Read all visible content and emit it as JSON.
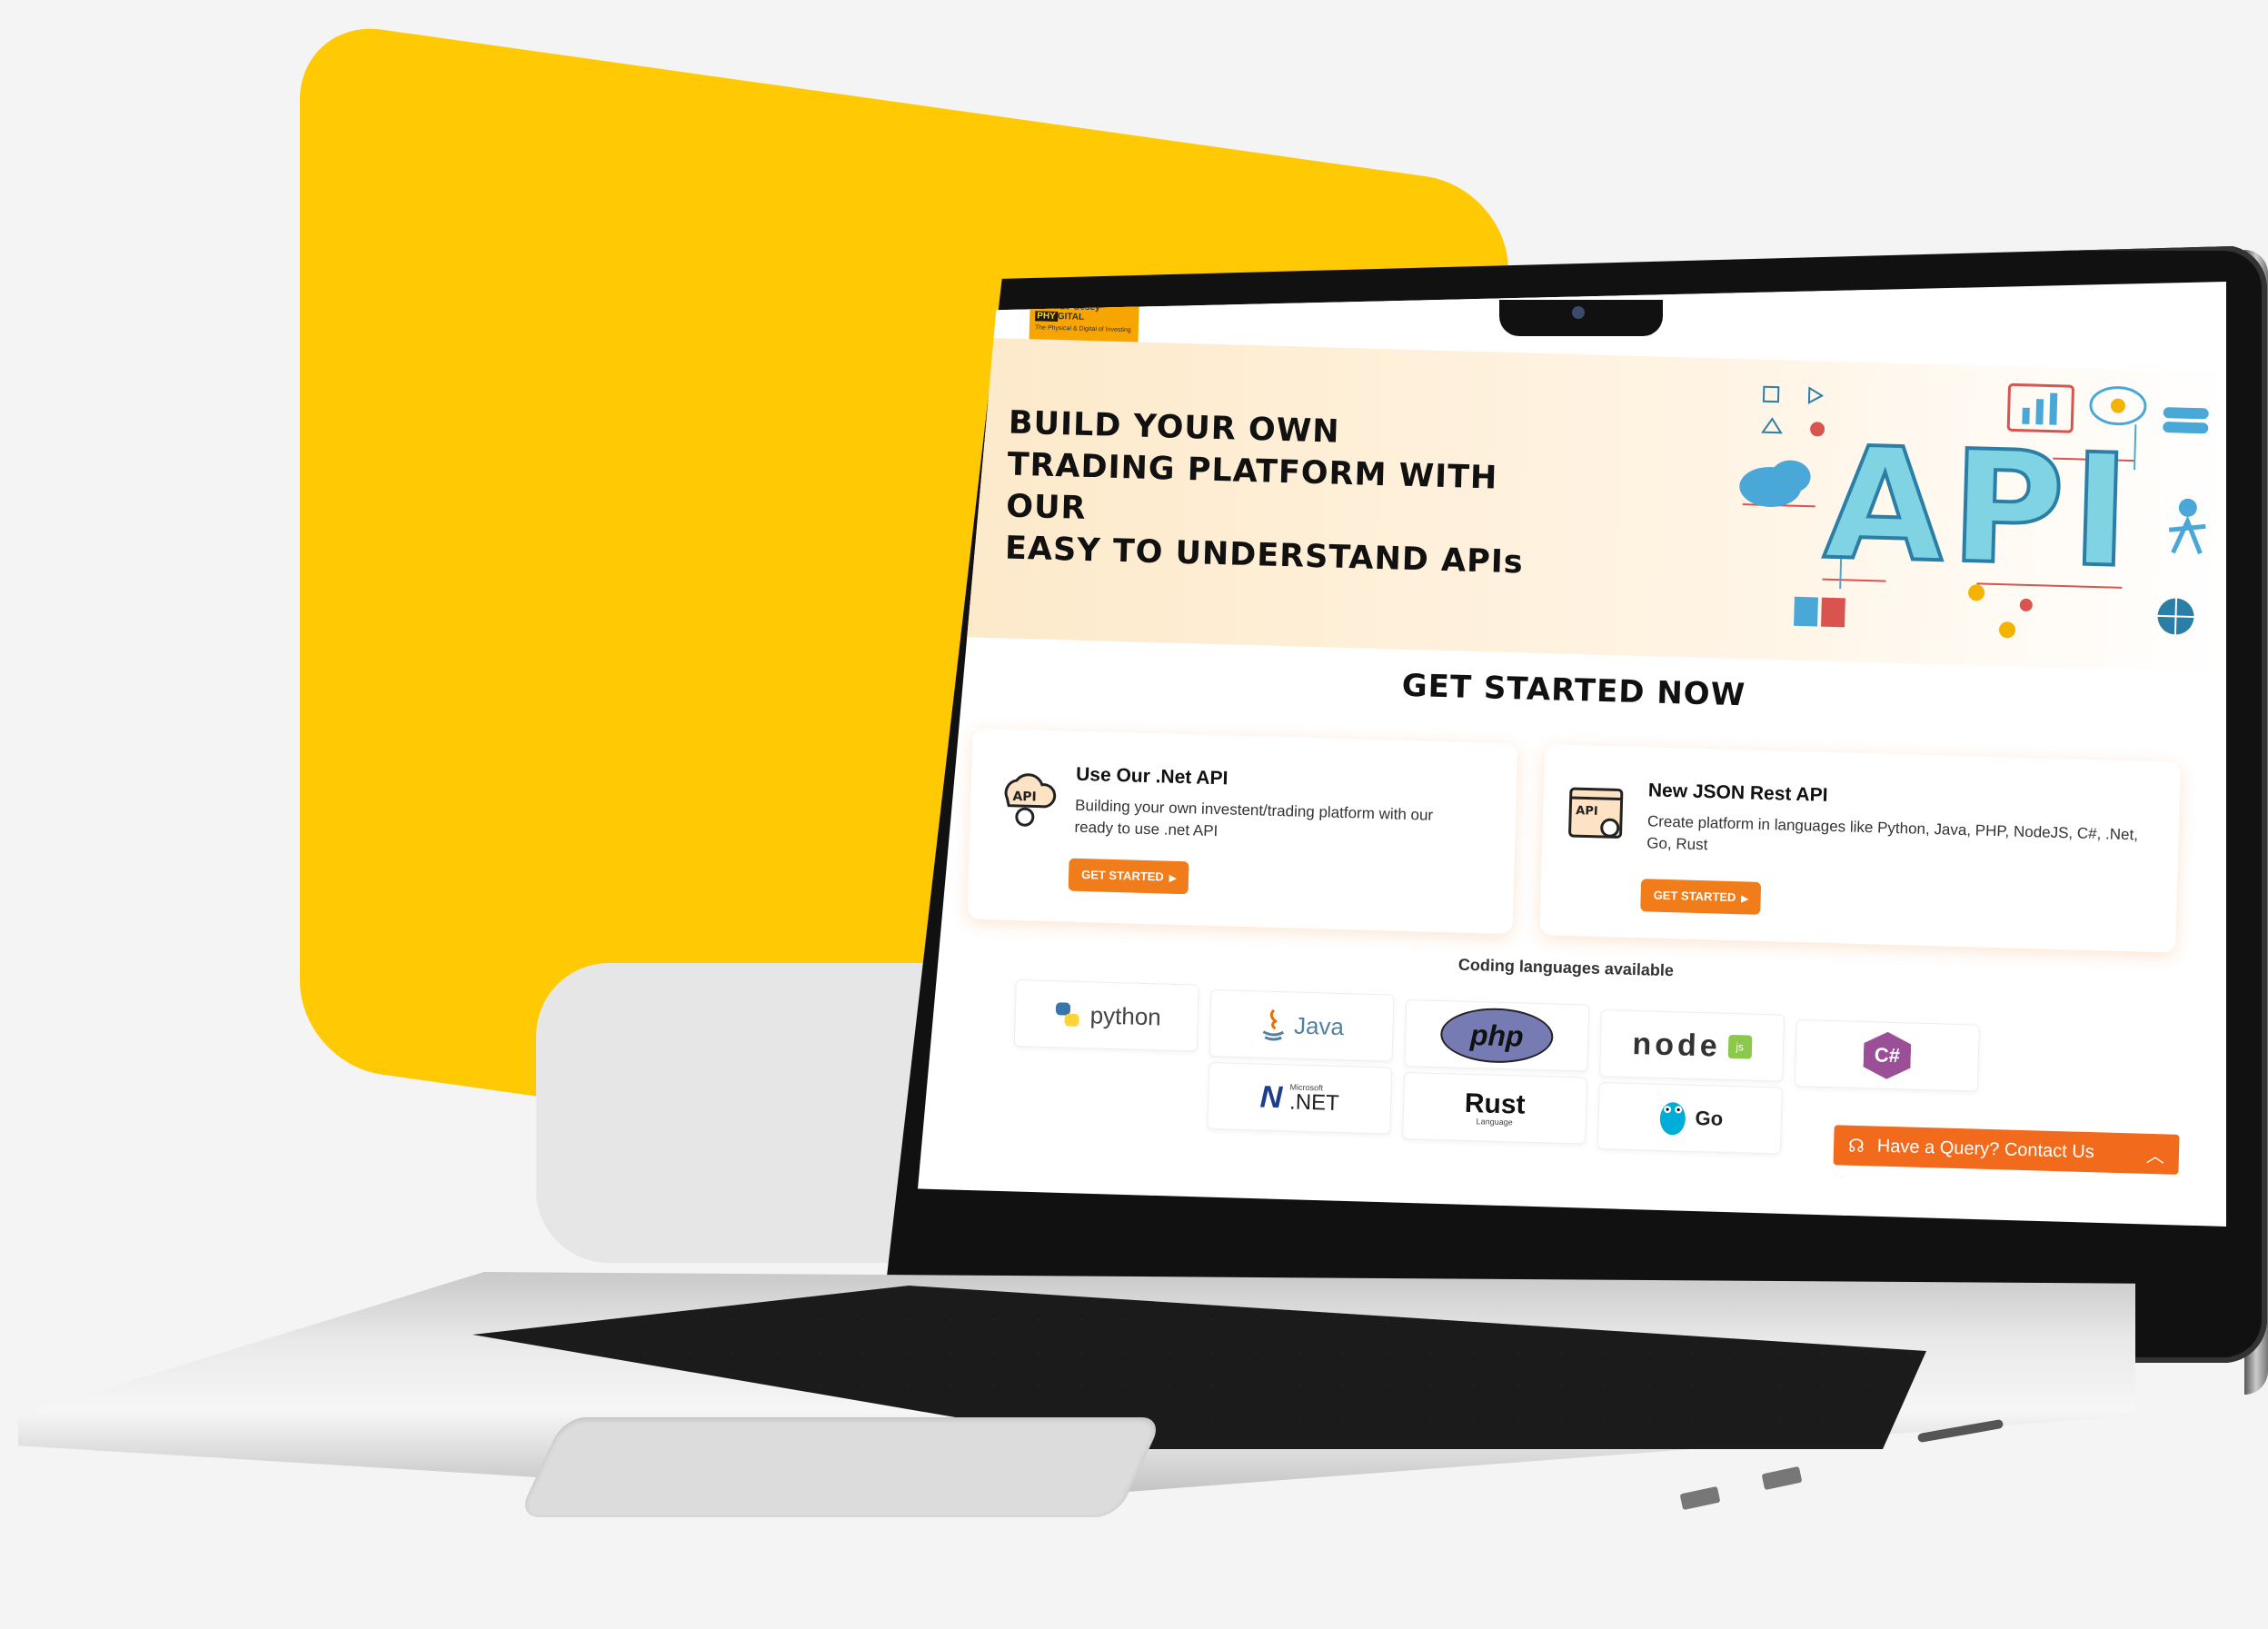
{
  "site": {
    "logo": {
      "brand_left": "Mastrus Gesey",
      "brand_box": "PHY",
      "brand_right": "GITAL",
      "tagline": "The Physical & Digital of Investing"
    },
    "hero": {
      "title_lines": [
        "BUILD YOUR OWN",
        "TRADING PLATFORM WITH OUR",
        "EASY TO UNDERSTAND APIs"
      ],
      "illustration_text": "API"
    },
    "section_title": "GET STARTED NOW",
    "cards": [
      {
        "icon": "api-cloud-gear-icon",
        "icon_text": "API",
        "title": "Use Our .Net API",
        "description": "Building your own investent/trading platform with our ready to use .net API",
        "button": "GET STARTED"
      },
      {
        "icon": "api-window-gear-icon",
        "icon_text": "API",
        "title": "New JSON Rest API",
        "description": "Create platform in languages like Python, Java, PHP, NodeJS, C#, .Net, Go, Rust",
        "button": "GET STARTED"
      }
    ],
    "languages_title": "Coding languages available",
    "languages": [
      {
        "label": "python",
        "icon": "python-logo-icon",
        "color": "#3776ab"
      },
      {
        "label": "Java",
        "icon": "java-logo-icon",
        "color": "#e76f00"
      },
      {
        "label": "php",
        "icon": "php-logo-icon",
        "color": "#777bb3"
      },
      {
        "label": "node",
        "icon": "nodejs-logo-icon",
        "color": "#333333"
      },
      {
        "label": "C#",
        "icon": "csharp-logo-icon",
        "color": "#9b4f96"
      },
      {
        "label": ".NET",
        "icon": "dotnet-logo-icon",
        "color": "#1f3e8a"
      },
      {
        "label": "Rust",
        "icon": "rust-logo-icon",
        "color": "#111111"
      },
      {
        "label": "Go",
        "icon": "go-gopher-icon",
        "color": "#00add8"
      }
    ],
    "dotnet_sub": "Microsoft",
    "rust_sub": "Language",
    "node_sub": "js",
    "contact": {
      "label": "Have a Query? Contact Us",
      "icon": "headset-icon",
      "chevron": "chevron-up-icon"
    }
  },
  "colors": {
    "accent": "#f07c1a",
    "background_shape": "#ffc904",
    "hero_bg": "#fde9c9"
  }
}
